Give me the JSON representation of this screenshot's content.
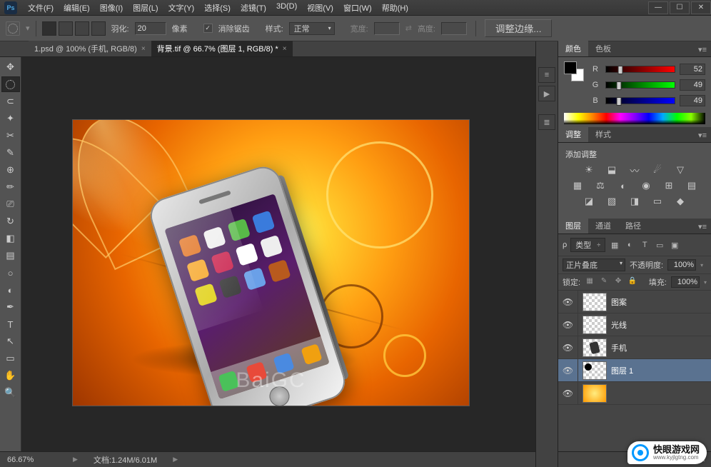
{
  "menu": [
    "文件(F)",
    "编辑(E)",
    "图像(I)",
    "图层(L)",
    "文字(Y)",
    "选择(S)",
    "滤镜(T)",
    "3D(D)",
    "视图(V)",
    "窗口(W)",
    "帮助(H)"
  ],
  "options": {
    "feather_label": "羽化:",
    "feather_value": "20",
    "feather_unit": "像素",
    "antialias": "消除锯齿",
    "style_label": "样式:",
    "style_value": "正常",
    "width_label": "宽度:",
    "height_label": "高度:",
    "refine_edge": "调整边缘..."
  },
  "tabs": [
    {
      "label": "1.psd @ 100% (手机, RGB/8)",
      "active": false
    },
    {
      "label": "背景.tif @ 66.7% (图层 1, RGB/8) *",
      "active": true
    }
  ],
  "color_panel": {
    "tabs": [
      "颜色",
      "色板"
    ],
    "r": "52",
    "g": "49",
    "b": "49",
    "r_label": "R",
    "g_label": "G",
    "b_label": "B"
  },
  "adjust_panel": {
    "tabs": [
      "调整",
      "样式"
    ],
    "title": "添加调整"
  },
  "layers_panel": {
    "tabs": [
      "图层",
      "通道",
      "路径"
    ],
    "kind": "类型",
    "blend": "正片叠底",
    "opacity_label": "不透明度:",
    "opacity": "100%",
    "lock_label": "锁定:",
    "fill_label": "填充:",
    "fill": "100%",
    "layers": [
      {
        "name": "图案"
      },
      {
        "name": "光线"
      },
      {
        "name": "手机"
      },
      {
        "name": "图层 1",
        "selected": true
      }
    ]
  },
  "status": {
    "zoom": "66.67%",
    "doc": "文档:1.24M/6.01M"
  },
  "brand": {
    "name": "快眼游戏网",
    "url": "www.kyjlgtng.com"
  }
}
